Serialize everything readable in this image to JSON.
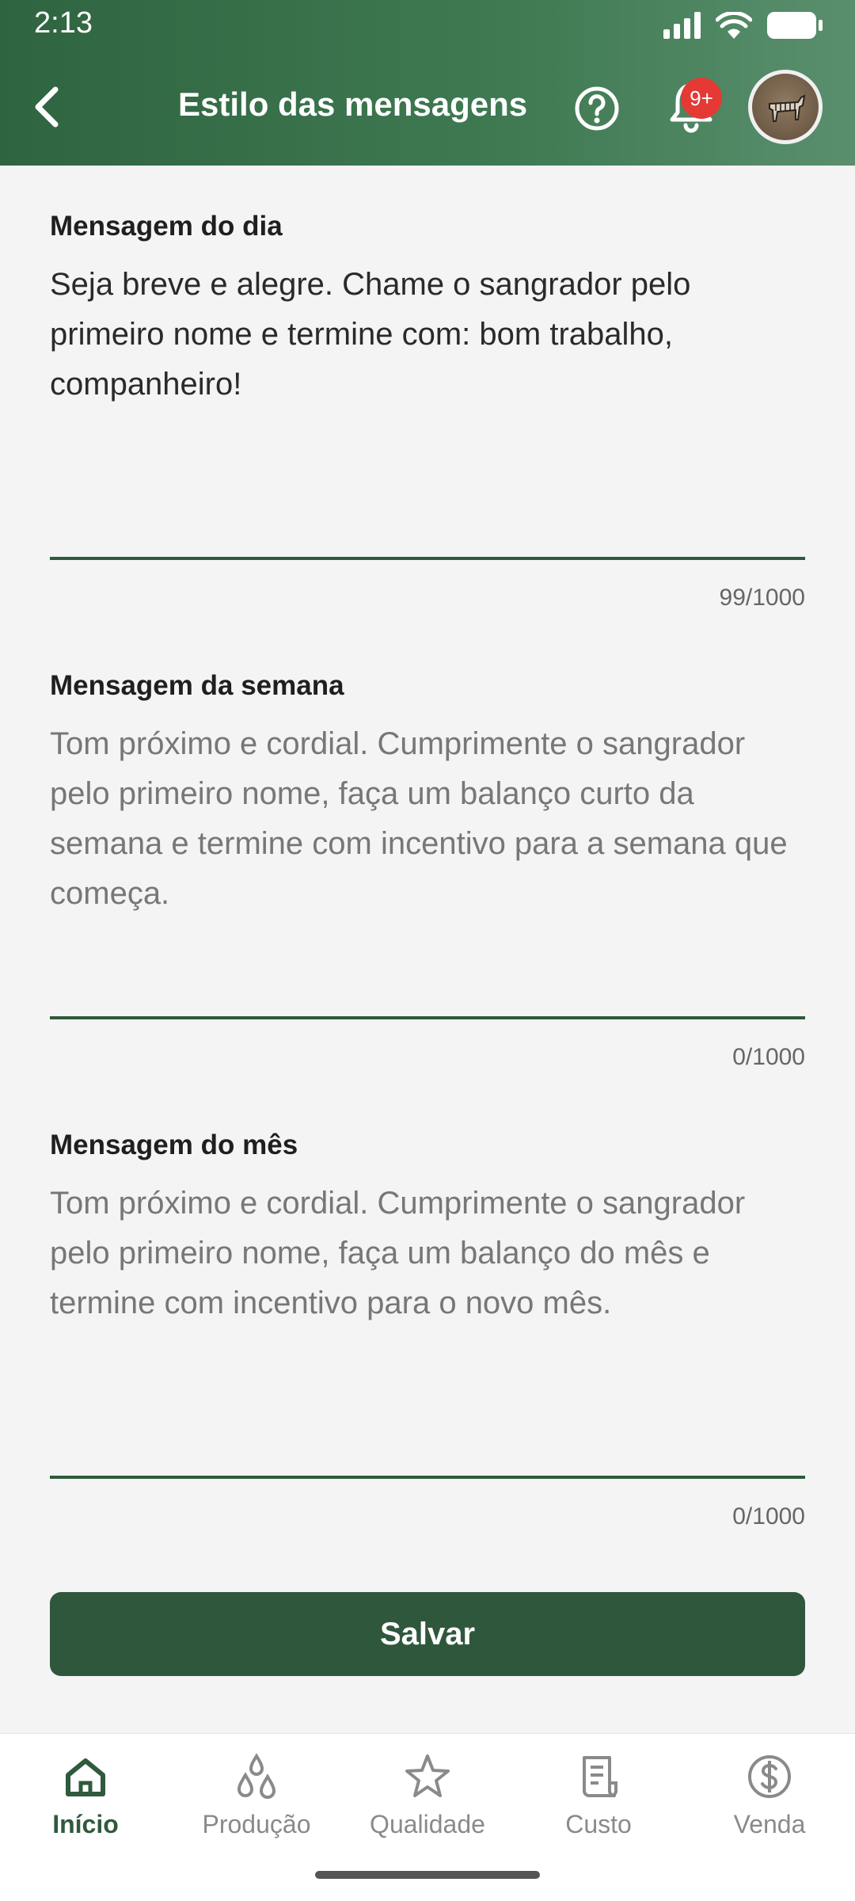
{
  "status_bar": {
    "time": "2:13"
  },
  "header": {
    "title": "Estilo das mensagens",
    "notification_badge": "9+",
    "icons": {
      "back": "back-arrow-icon",
      "help": "help-circle-icon",
      "bell": "bell-icon"
    }
  },
  "sections": [
    {
      "label": "Mensagem do dia",
      "text": "Seja breve e alegre. Chame o sangrador pelo primeiro nome e termine com: bom trabalho, companheiro!",
      "is_placeholder": false,
      "counter": "99/1000"
    },
    {
      "label": "Mensagem da semana",
      "text": "Tom próximo e cordial. Cumprimente o sangrador pelo primeiro nome, faça um balanço curto da semana e termine com incentivo para a semana que começa.",
      "is_placeholder": true,
      "counter": "0/1000"
    },
    {
      "label": "Mensagem do mês",
      "text": "Tom próximo e cordial. Cumprimente o sangrador pelo primeiro nome, faça um balanço do mês e termine com incentivo para o novo mês.",
      "is_placeholder": true,
      "counter": "0/1000"
    }
  ],
  "save_button": {
    "label": "Salvar"
  },
  "bottom_nav": {
    "items": [
      {
        "label": "Início",
        "icon": "home-icon",
        "active": true
      },
      {
        "label": "Produção",
        "icon": "drops-icon",
        "active": false
      },
      {
        "label": "Qualidade",
        "icon": "star-icon",
        "active": false
      },
      {
        "label": "Custo",
        "icon": "receipt-icon",
        "active": false
      },
      {
        "label": "Venda",
        "icon": "dollar-circle-icon",
        "active": false
      }
    ]
  },
  "colors": {
    "header_green": "#3f7a52",
    "primary_dark_green": "#2f573c",
    "badge_red": "#e53935",
    "background": "#f4f4f4"
  }
}
